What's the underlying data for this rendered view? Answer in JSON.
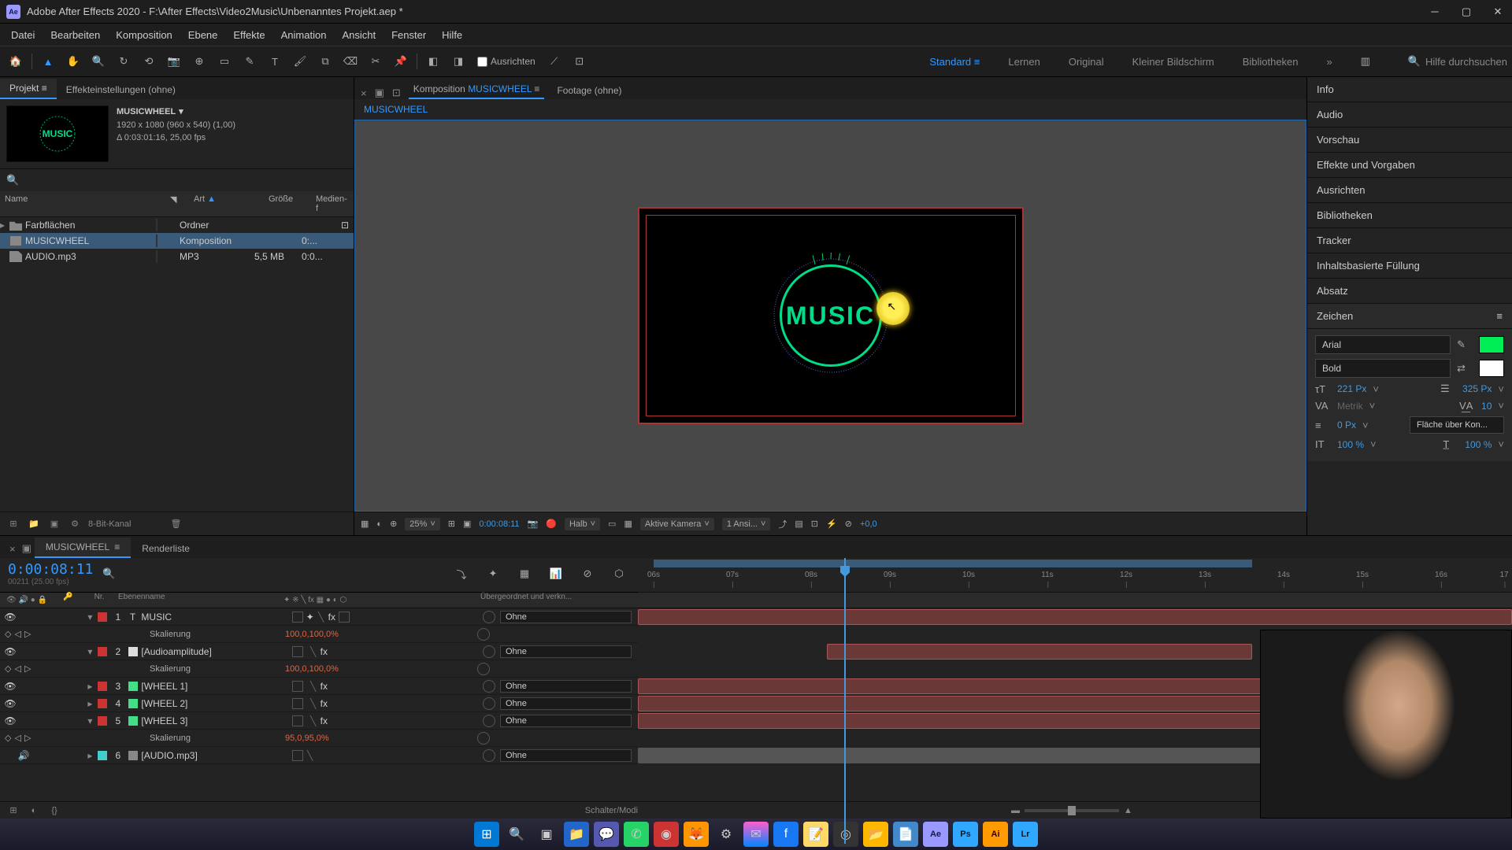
{
  "titlebar": {
    "app_icon": "Ae",
    "title": "Adobe After Effects 2020 - F:\\After Effects\\Video2Music\\Unbenanntes Projekt.aep *"
  },
  "menu": {
    "items": [
      "Datei",
      "Bearbeiten",
      "Komposition",
      "Ebene",
      "Effekte",
      "Animation",
      "Ansicht",
      "Fenster",
      "Hilfe"
    ]
  },
  "toolbar": {
    "ausrichten": "Ausrichten",
    "workspaces": [
      "Standard",
      "Lernen",
      "Original",
      "Kleiner Bildschirm",
      "Bibliotheken"
    ],
    "active_workspace": "Standard",
    "search_placeholder": "Hilfe durchsuchen"
  },
  "project_panel": {
    "tabs": {
      "projekt": "Projekt",
      "effekt": "Effekteinstellungen  (ohne)"
    },
    "comp_preview": {
      "name": "MUSICWHEEL",
      "res": "1920 x 1080 (960 x 540) (1,00)",
      "dur": "Δ 0:03:01:16, 25,00 fps",
      "thumb_text": "MUSIC"
    },
    "columns": {
      "name": "Name",
      "art": "Art",
      "size": "Größe",
      "media": "Medien-f"
    },
    "rows": [
      {
        "name": "Farbflächen",
        "art": "Ordner",
        "size": "",
        "media": "",
        "icon": "folder",
        "toggle": "▸"
      },
      {
        "name": "MUSICWHEEL",
        "art": "Komposition",
        "size": "",
        "media": "0:...",
        "icon": "comp",
        "selected": true
      },
      {
        "name": "AUDIO.mp3",
        "art": "MP3",
        "size": "5,5 MB",
        "media": "0:0...",
        "icon": "file"
      }
    ],
    "footer_depth": "8-Bit-Kanal"
  },
  "comp_panel": {
    "tab_prefix": "Komposition",
    "tab_name": "MUSICWHEEL",
    "footage_tab": "Footage  (ohne)",
    "breadcrumb": "MUSICWHEEL",
    "canvas_text": "MUSIC",
    "footer": {
      "zoom": "25%",
      "timecode": "0:00:08:11",
      "res": "Halb",
      "camera": "Aktive Kamera",
      "views": "1 Ansi...",
      "exposure": "+0,0"
    }
  },
  "right_panels": {
    "items": [
      "Info",
      "Audio",
      "Vorschau",
      "Effekte und Vorgaben",
      "Ausrichten",
      "Bibliotheken",
      "Tracker",
      "Inhaltsbasierte Füllung",
      "Absatz",
      "Zeichen"
    ],
    "zeichen": {
      "font": "Arial",
      "style": "Bold",
      "size": "221 Px",
      "leading": "325 Px",
      "kerning": "Metrik",
      "tracking": "10",
      "stroke": "0 Px",
      "stroke_mode": "Fläche über Kon...",
      "vscale": "100 %",
      "hscale": "100 %"
    }
  },
  "timeline": {
    "tab_name": "MUSICWHEEL",
    "renderliste": "Renderliste",
    "timecode": "0:00:08:11",
    "subcode": "00211 (25.00 fps)",
    "columns": {
      "nr": "Nr.",
      "name": "Ebenenname",
      "parent": "Übergeordnet und verkn..."
    },
    "ruler_ticks": [
      "06s",
      "07s",
      "08s",
      "09s",
      "10s",
      "11s",
      "12s",
      "13s",
      "14s",
      "15s",
      "16s",
      "17"
    ],
    "layers": [
      {
        "nr": "1",
        "name": "MUSIC",
        "label": "red",
        "type": "T",
        "parent": "Ohne",
        "eye": true,
        "expanded": true
      },
      {
        "nr": "2",
        "name": "[Audioamplitude]",
        "label": "none",
        "type": "solid",
        "parent": "Ohne",
        "eye": true,
        "expanded": true
      },
      {
        "nr": "3",
        "name": "[WHEEL 1]",
        "label": "red",
        "type": "solid",
        "parent": "Ohne",
        "eye": true
      },
      {
        "nr": "4",
        "name": "[WHEEL 2]",
        "label": "red",
        "type": "solid",
        "parent": "Ohne",
        "eye": true
      },
      {
        "nr": "5",
        "name": "[WHEEL 3]",
        "label": "red",
        "type": "solid",
        "parent": "Ohne",
        "eye": true,
        "expanded": true
      },
      {
        "nr": "6",
        "name": "[AUDIO.mp3]",
        "label": "cyan",
        "type": "audio",
        "parent": "Ohne",
        "audio": true
      }
    ],
    "props": {
      "skalierung": "Skalierung",
      "val100": "100,0,100,0%",
      "val95": "95,0,95,0%"
    },
    "footer": "Schalter/Modi"
  }
}
